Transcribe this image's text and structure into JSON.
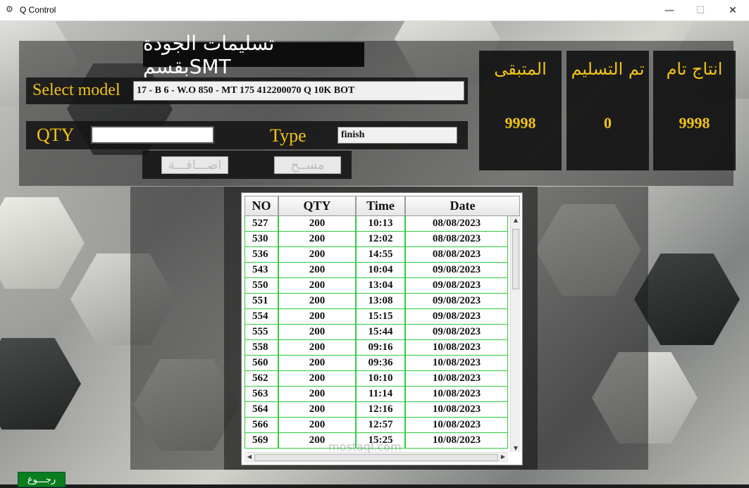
{
  "window": {
    "title": "Q Control",
    "icon": "gear-icon",
    "minimize": "—",
    "maximize": "☐",
    "close": "✕"
  },
  "header": {
    "title": "تسليمات الجودة بقسمSMT"
  },
  "form": {
    "select_model_label": "Select model",
    "select_model_value": "17 - B 6 - W.O 850 - MT 175 412200070 Q 10K BOT",
    "qty_label": "QTY",
    "qty_value": "",
    "type_label": "Type",
    "type_value": "finish",
    "add_button": "اضـــافـــة",
    "delete_button": "مســح"
  },
  "stats": {
    "produced_label": "انتاج تام",
    "produced_value": "9998",
    "delivered_label": "تم التسليم",
    "delivered_value": "0",
    "remaining_label": "المتبقى",
    "remaining_value": "9998"
  },
  "table": {
    "columns": [
      "NO",
      "QTY",
      "Time",
      "Date"
    ],
    "rows": [
      [
        "527",
        "200",
        "10:13",
        "08/08/2023"
      ],
      [
        "530",
        "200",
        "12:02",
        "08/08/2023"
      ],
      [
        "536",
        "200",
        "14:55",
        "08/08/2023"
      ],
      [
        "543",
        "200",
        "10:04",
        "09/08/2023"
      ],
      [
        "550",
        "200",
        "13:04",
        "09/08/2023"
      ],
      [
        "551",
        "200",
        "13:08",
        "09/08/2023"
      ],
      [
        "554",
        "200",
        "15:15",
        "09/08/2023"
      ],
      [
        "555",
        "200",
        "15:44",
        "09/08/2023"
      ],
      [
        "558",
        "200",
        "09:16",
        "10/08/2023"
      ],
      [
        "560",
        "200",
        "09:36",
        "10/08/2023"
      ],
      [
        "562",
        "200",
        "10:10",
        "10/08/2023"
      ],
      [
        "563",
        "200",
        "11:14",
        "10/08/2023"
      ],
      [
        "564",
        "200",
        "12:16",
        "10/08/2023"
      ],
      [
        "566",
        "200",
        "12:57",
        "10/08/2023"
      ],
      [
        "569",
        "200",
        "15:25",
        "10/08/2023"
      ]
    ]
  },
  "footer": {
    "back_button": "رجـــوع",
    "watermark": "mostaql.com"
  }
}
